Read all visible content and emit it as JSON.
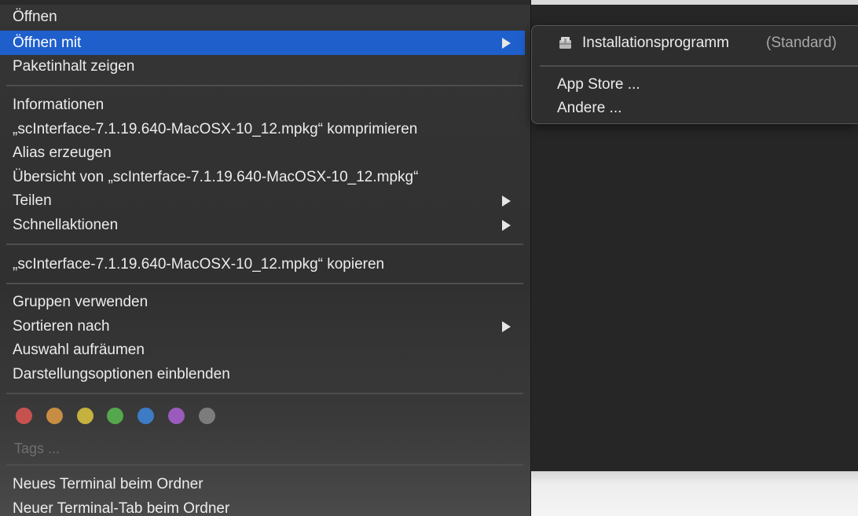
{
  "context_menu": {
    "items": [
      {
        "label": "Öffnen"
      },
      {
        "label": "Öffnen mit",
        "highlighted": true,
        "has_submenu": true
      },
      {
        "label": "Paketinhalt zeigen"
      },
      {
        "label": "Informationen"
      },
      {
        "label": "„scInterface-7.1.19.640-MacOSX-10_12.mpkg“ komprimieren"
      },
      {
        "label": "Alias erzeugen"
      },
      {
        "label": "Übersicht von „scInterface-7.1.19.640-MacOSX-10_12.mpkg“"
      },
      {
        "label": "Teilen",
        "has_submenu": true
      },
      {
        "label": "Schnellaktionen",
        "has_submenu": true
      },
      {
        "label": "„scInterface-7.1.19.640-MacOSX-10_12.mpkg“ kopieren"
      },
      {
        "label": "Gruppen verwenden"
      },
      {
        "label": "Sortieren nach",
        "has_submenu": true
      },
      {
        "label": "Auswahl aufräumen"
      },
      {
        "label": "Darstellungsoptionen einblenden"
      },
      {
        "label": "Neues Terminal beim Ordner"
      },
      {
        "label": "Neuer Terminal-Tab beim Ordner"
      }
    ],
    "tags": {
      "placeholder": "Tags ...",
      "colors": [
        {
          "name": "red",
          "hex": "#c6524f"
        },
        {
          "name": "orange",
          "hex": "#c88d45"
        },
        {
          "name": "yellow",
          "hex": "#c4b13e"
        },
        {
          "name": "green",
          "hex": "#55a74d"
        },
        {
          "name": "blue",
          "hex": "#3d7cc4"
        },
        {
          "name": "purple",
          "hex": "#9a5bbd"
        },
        {
          "name": "gray",
          "hex": "#7c7c7c"
        }
      ]
    }
  },
  "open_with_submenu": {
    "default_app": {
      "name": "Installationsprogramm",
      "suffix": "(Standard)",
      "icon": "installer-icon"
    },
    "items": [
      {
        "label": "App Store ..."
      },
      {
        "label": "Andere ..."
      }
    ]
  },
  "colors": {
    "highlight": "#1e5fcc",
    "menu_background": "#323232",
    "text": "#ececec"
  }
}
